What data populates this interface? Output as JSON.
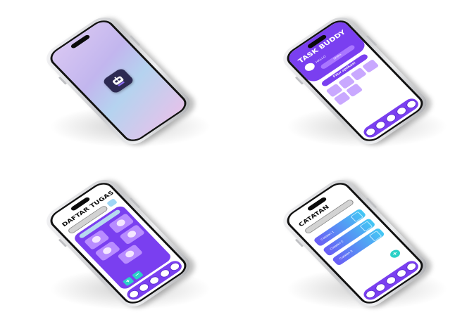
{
  "mockups": {
    "home": {
      "app_icon": "robot-mascot-icon"
    },
    "menu": {
      "title": "TASK BUDDY",
      "greeting": "HALLO",
      "user_name": "Shiko",
      "section": "Fitur aplikasi",
      "tiles": [
        "",
        "",
        "",
        "",
        "",
        ""
      ],
      "nav_icons": [
        "home-icon",
        "task-icon",
        "notes-icon",
        "calendar-icon",
        "profile-icon"
      ]
    },
    "tasks": {
      "title": "DAFTAR TUGAS",
      "chip": "",
      "add_label": "+",
      "remove_label": "−"
    },
    "notes": {
      "title": "CATATAN",
      "items": [
        "Catatan 1",
        "Catatan 2",
        "Catatan 3"
      ],
      "add_label": "+"
    }
  }
}
